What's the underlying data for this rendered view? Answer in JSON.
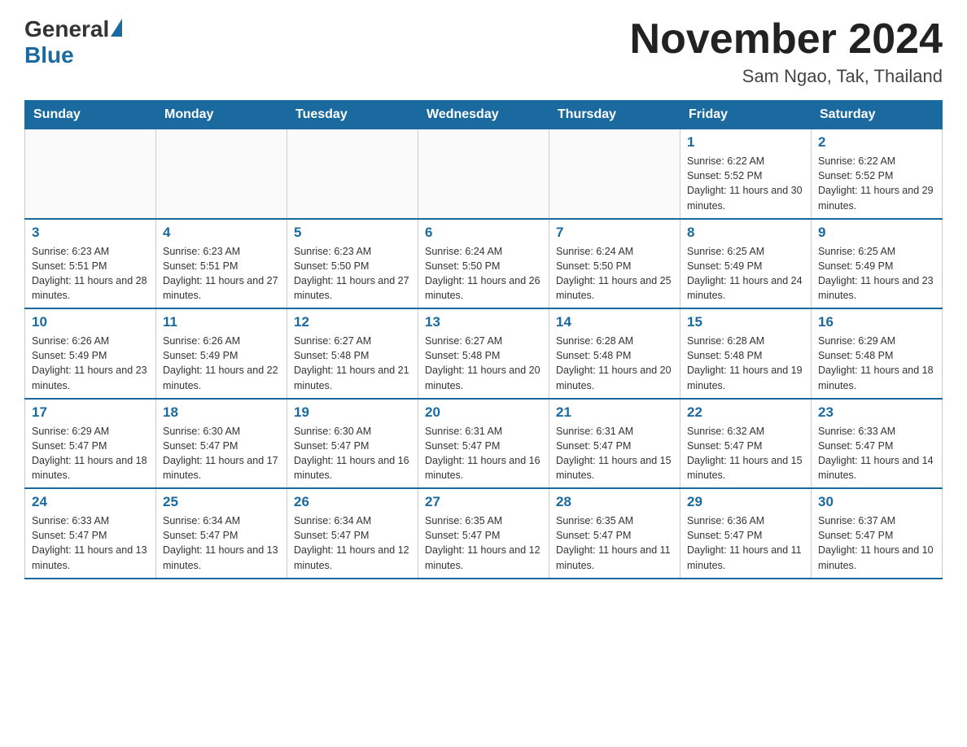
{
  "header": {
    "logo_general": "General",
    "logo_blue": "Blue",
    "title": "November 2024",
    "location": "Sam Ngao, Tak, Thailand"
  },
  "weekdays": [
    "Sunday",
    "Monday",
    "Tuesday",
    "Wednesday",
    "Thursday",
    "Friday",
    "Saturday"
  ],
  "weeks": [
    [
      {
        "day": "",
        "info": ""
      },
      {
        "day": "",
        "info": ""
      },
      {
        "day": "",
        "info": ""
      },
      {
        "day": "",
        "info": ""
      },
      {
        "day": "",
        "info": ""
      },
      {
        "day": "1",
        "info": "Sunrise: 6:22 AM\nSunset: 5:52 PM\nDaylight: 11 hours and 30 minutes."
      },
      {
        "day": "2",
        "info": "Sunrise: 6:22 AM\nSunset: 5:52 PM\nDaylight: 11 hours and 29 minutes."
      }
    ],
    [
      {
        "day": "3",
        "info": "Sunrise: 6:23 AM\nSunset: 5:51 PM\nDaylight: 11 hours and 28 minutes."
      },
      {
        "day": "4",
        "info": "Sunrise: 6:23 AM\nSunset: 5:51 PM\nDaylight: 11 hours and 27 minutes."
      },
      {
        "day": "5",
        "info": "Sunrise: 6:23 AM\nSunset: 5:50 PM\nDaylight: 11 hours and 27 minutes."
      },
      {
        "day": "6",
        "info": "Sunrise: 6:24 AM\nSunset: 5:50 PM\nDaylight: 11 hours and 26 minutes."
      },
      {
        "day": "7",
        "info": "Sunrise: 6:24 AM\nSunset: 5:50 PM\nDaylight: 11 hours and 25 minutes."
      },
      {
        "day": "8",
        "info": "Sunrise: 6:25 AM\nSunset: 5:49 PM\nDaylight: 11 hours and 24 minutes."
      },
      {
        "day": "9",
        "info": "Sunrise: 6:25 AM\nSunset: 5:49 PM\nDaylight: 11 hours and 23 minutes."
      }
    ],
    [
      {
        "day": "10",
        "info": "Sunrise: 6:26 AM\nSunset: 5:49 PM\nDaylight: 11 hours and 23 minutes."
      },
      {
        "day": "11",
        "info": "Sunrise: 6:26 AM\nSunset: 5:49 PM\nDaylight: 11 hours and 22 minutes."
      },
      {
        "day": "12",
        "info": "Sunrise: 6:27 AM\nSunset: 5:48 PM\nDaylight: 11 hours and 21 minutes."
      },
      {
        "day": "13",
        "info": "Sunrise: 6:27 AM\nSunset: 5:48 PM\nDaylight: 11 hours and 20 minutes."
      },
      {
        "day": "14",
        "info": "Sunrise: 6:28 AM\nSunset: 5:48 PM\nDaylight: 11 hours and 20 minutes."
      },
      {
        "day": "15",
        "info": "Sunrise: 6:28 AM\nSunset: 5:48 PM\nDaylight: 11 hours and 19 minutes."
      },
      {
        "day": "16",
        "info": "Sunrise: 6:29 AM\nSunset: 5:48 PM\nDaylight: 11 hours and 18 minutes."
      }
    ],
    [
      {
        "day": "17",
        "info": "Sunrise: 6:29 AM\nSunset: 5:47 PM\nDaylight: 11 hours and 18 minutes."
      },
      {
        "day": "18",
        "info": "Sunrise: 6:30 AM\nSunset: 5:47 PM\nDaylight: 11 hours and 17 minutes."
      },
      {
        "day": "19",
        "info": "Sunrise: 6:30 AM\nSunset: 5:47 PM\nDaylight: 11 hours and 16 minutes."
      },
      {
        "day": "20",
        "info": "Sunrise: 6:31 AM\nSunset: 5:47 PM\nDaylight: 11 hours and 16 minutes."
      },
      {
        "day": "21",
        "info": "Sunrise: 6:31 AM\nSunset: 5:47 PM\nDaylight: 11 hours and 15 minutes."
      },
      {
        "day": "22",
        "info": "Sunrise: 6:32 AM\nSunset: 5:47 PM\nDaylight: 11 hours and 15 minutes."
      },
      {
        "day": "23",
        "info": "Sunrise: 6:33 AM\nSunset: 5:47 PM\nDaylight: 11 hours and 14 minutes."
      }
    ],
    [
      {
        "day": "24",
        "info": "Sunrise: 6:33 AM\nSunset: 5:47 PM\nDaylight: 11 hours and 13 minutes."
      },
      {
        "day": "25",
        "info": "Sunrise: 6:34 AM\nSunset: 5:47 PM\nDaylight: 11 hours and 13 minutes."
      },
      {
        "day": "26",
        "info": "Sunrise: 6:34 AM\nSunset: 5:47 PM\nDaylight: 11 hours and 12 minutes."
      },
      {
        "day": "27",
        "info": "Sunrise: 6:35 AM\nSunset: 5:47 PM\nDaylight: 11 hours and 12 minutes."
      },
      {
        "day": "28",
        "info": "Sunrise: 6:35 AM\nSunset: 5:47 PM\nDaylight: 11 hours and 11 minutes."
      },
      {
        "day": "29",
        "info": "Sunrise: 6:36 AM\nSunset: 5:47 PM\nDaylight: 11 hours and 11 minutes."
      },
      {
        "day": "30",
        "info": "Sunrise: 6:37 AM\nSunset: 5:47 PM\nDaylight: 11 hours and 10 minutes."
      }
    ]
  ]
}
